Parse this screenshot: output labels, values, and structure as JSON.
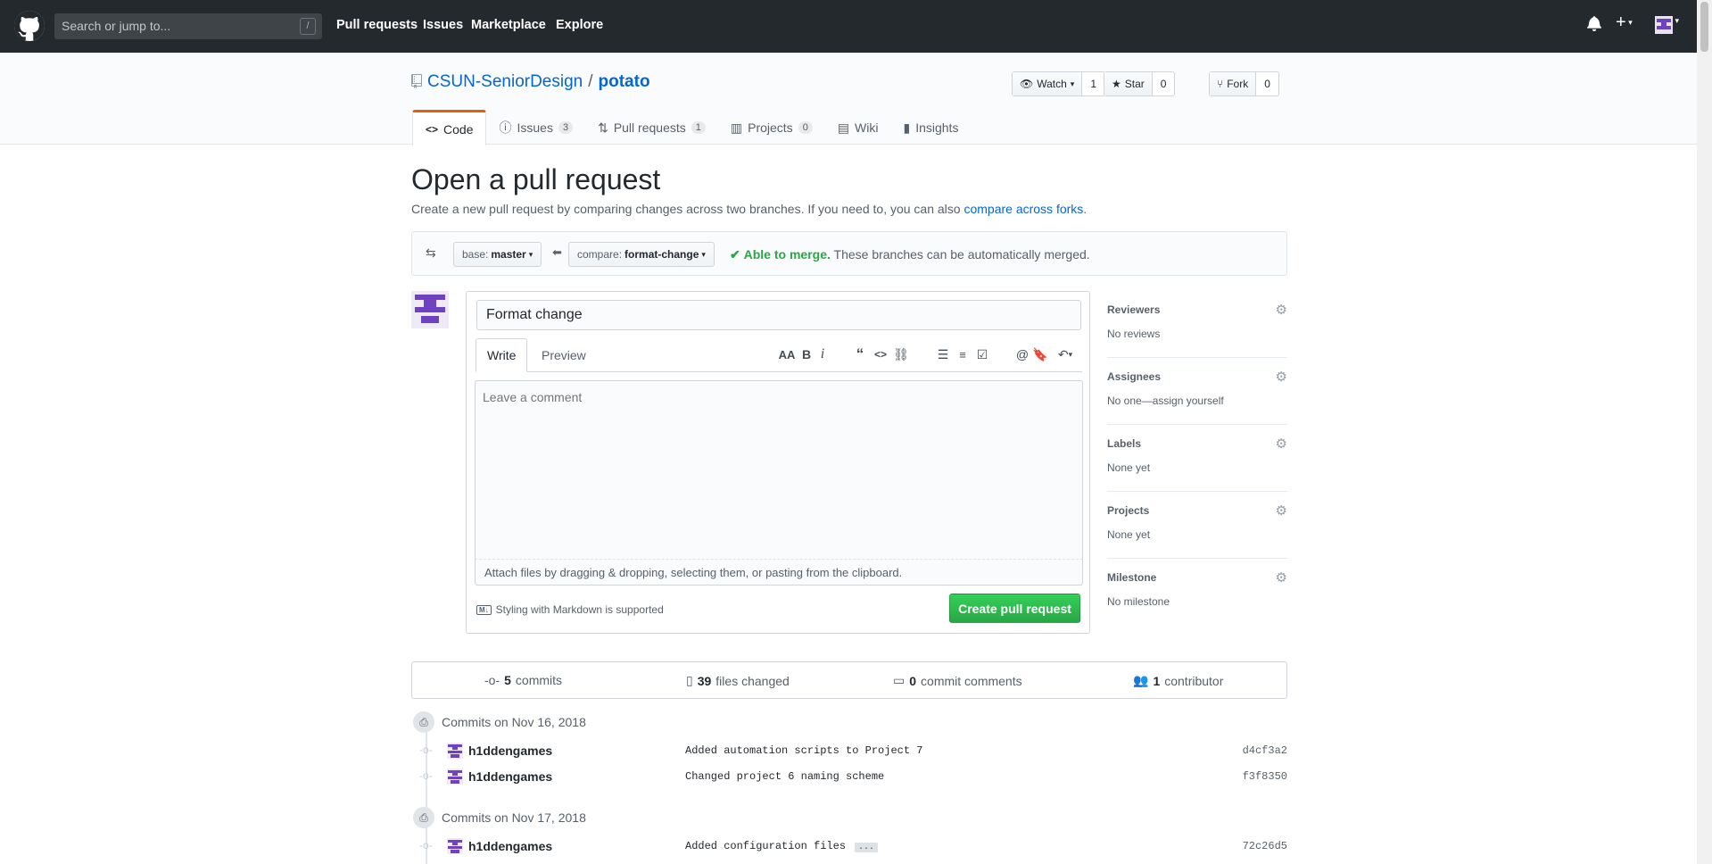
{
  "header": {
    "search_placeholder": "Search or jump to...",
    "search_shortcut": "/",
    "nav": [
      "Pull requests",
      "Issues",
      "Marketplace",
      "Explore"
    ]
  },
  "repo": {
    "owner": "CSUN-SeniorDesign",
    "separator": "/",
    "name": "potato",
    "watch_label": "Watch",
    "watch_count": "1",
    "star_label": "Star",
    "star_count": "0",
    "fork_label": "Fork",
    "fork_count": "0",
    "tabs": [
      {
        "label": "Code",
        "count": ""
      },
      {
        "label": "Issues",
        "count": "3"
      },
      {
        "label": "Pull requests",
        "count": "1"
      },
      {
        "label": "Projects",
        "count": "0"
      },
      {
        "label": "Wiki",
        "count": ""
      },
      {
        "label": "Insights",
        "count": ""
      }
    ]
  },
  "page": {
    "title": "Open a pull request",
    "subtitle": "Create a new pull request by comparing changes across two branches. If you need to, you can also",
    "subtitle_link": "compare across forks",
    "subtitle_end": "."
  },
  "range": {
    "base_prefix": "base:",
    "base_branch": "master",
    "compare_prefix": "compare:",
    "compare_branch": "format-change",
    "merge_status": "Able to merge.",
    "merge_detail": "These branches can be automatically merged."
  },
  "form": {
    "title_value": "Format change",
    "write_tab": "Write",
    "preview_tab": "Preview",
    "comment_placeholder": "Leave a comment",
    "attach_text": "Attach files by dragging & dropping, selecting them, or pasting from the clipboard.",
    "markdown_text": "Styling with Markdown is supported",
    "submit_label": "Create pull request"
  },
  "sidebar": [
    {
      "heading": "Reviewers",
      "value": "No reviews"
    },
    {
      "heading": "Assignees",
      "value": "No one—assign yourself"
    },
    {
      "heading": "Labels",
      "value": "None yet"
    },
    {
      "heading": "Projects",
      "value": "None yet"
    },
    {
      "heading": "Milestone",
      "value": "No milestone"
    }
  ],
  "summary": {
    "commits_count": "5",
    "commits_label": "commits",
    "files_count": "39",
    "files_label": "files changed",
    "comments_count": "0",
    "comments_label": "commit comments",
    "contributors_count": "1",
    "contributors_label": "contributor"
  },
  "commit_groups": [
    {
      "date_label": "Commits on Nov 16, 2018",
      "commits": [
        {
          "author": "h1ddengames",
          "message": "Added automation scripts to Project 7",
          "sha": "d4cf3a2"
        },
        {
          "author": "h1ddengames",
          "message": "Changed project 6 naming scheme",
          "sha": "f3f8350"
        }
      ]
    },
    {
      "date_label": "Commits on Nov 17, 2018",
      "commits": [
        {
          "author": "h1ddengames",
          "message": "Added configuration files",
          "sha": "72c26d5",
          "ellipsis": "..."
        }
      ]
    }
  ],
  "colors": {
    "header_bg": "#24292e",
    "link": "#0366d6",
    "active_tab": "#e36209",
    "success": "#28a745",
    "avatar": "#6f42c1"
  }
}
